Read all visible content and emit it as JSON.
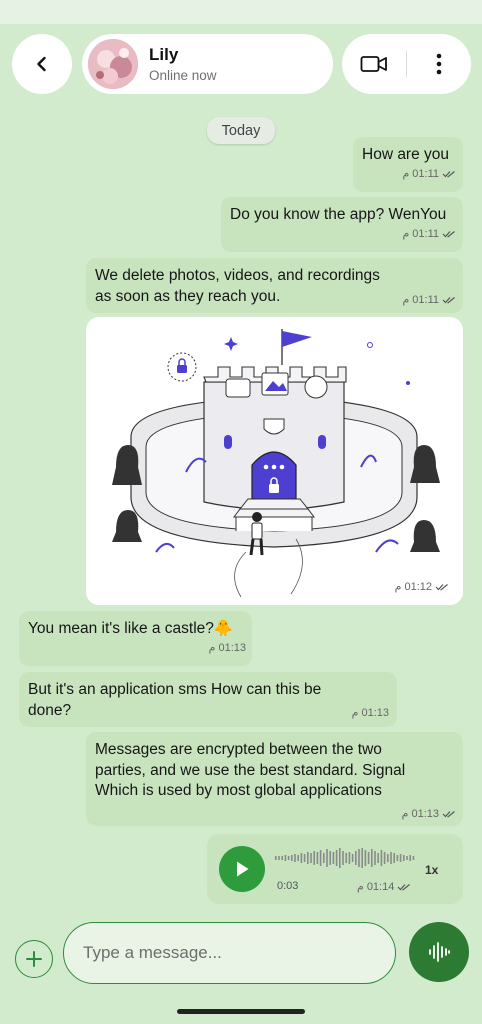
{
  "header": {
    "contact_name": "Lily",
    "contact_status": "Online now",
    "icons": {
      "back": "chevron-left-icon",
      "video": "video-camera-icon",
      "more": "more-vertical-icon"
    }
  },
  "date_separator": "Today",
  "messages": [
    {
      "text": "How are you",
      "time": "01:11",
      "ampm": "م",
      "status": "read"
    },
    {
      "text": "Do you know the app? WenYou",
      "time": "01:11",
      "ampm": "م",
      "status": "read"
    },
    {
      "text": "We delete photos, videos, and recordings as soon as they reach you.",
      "time": "01:11",
      "ampm": "م",
      "status": "read"
    },
    {
      "type": "image",
      "time": "01:12",
      "ampm": "م",
      "status": "read"
    },
    {
      "text": "You mean it's like a castle?🐥",
      "time": "01:13",
      "ampm": "م"
    },
    {
      "text": "But it's an application sms How can this be done?",
      "time": "01:13",
      "ampm": "م"
    },
    {
      "text": "Messages are encrypted between the two parties, and we use the best standard. Signal Which is used by most global applications",
      "time": "01:13",
      "ampm": "م",
      "status": "read"
    },
    {
      "type": "voice",
      "duration": "0:03",
      "speed": "1x",
      "time": "01:14",
      "ampm": "م",
      "status": "read"
    }
  ],
  "composer": {
    "placeholder": "Type a message...",
    "icons": {
      "add": "plus-icon",
      "mic": "mic-waveform-icon"
    }
  },
  "colors": {
    "background": "#d3ebcd",
    "bubble": "#c7e4bf",
    "accent": "#2e8b3c",
    "play": "#2e9c3d",
    "mic": "#2d7a33"
  }
}
